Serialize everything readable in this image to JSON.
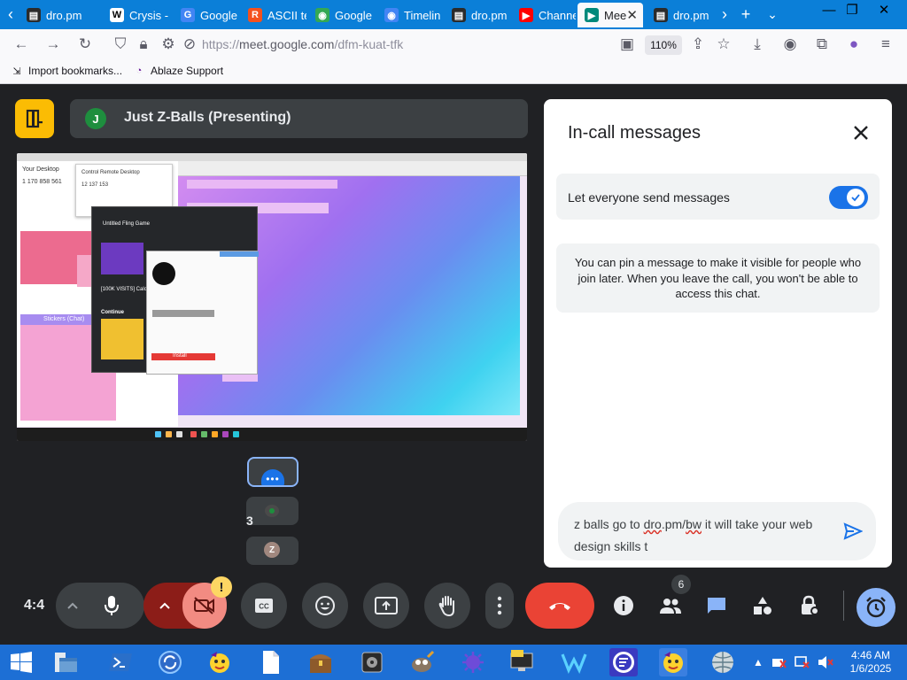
{
  "browser": {
    "tabs": [
      {
        "label": "dro.pm",
        "icon": "film-icon",
        "color": "#2b2b2b"
      },
      {
        "label": "Crysis -",
        "icon": "wikipedia-icon",
        "color": "#ffffff"
      },
      {
        "label": "Google",
        "icon": "google-translate-icon",
        "color": "#4285f4"
      },
      {
        "label": "ASCII te",
        "icon": "r-icon",
        "color": "#f4511e"
      },
      {
        "label": "Google",
        "icon": "maps-pin-icon",
        "color": "#34a853"
      },
      {
        "label": "Timelin",
        "icon": "maps-pin-icon",
        "color": "#4285f4"
      },
      {
        "label": "dro.pm",
        "icon": "film-icon",
        "color": "#2b2b2b"
      },
      {
        "label": "Channe",
        "icon": "youtube-icon",
        "color": "#ff0000"
      },
      {
        "label": "Mee",
        "icon": "meet-icon",
        "color": "#00897b"
      },
      {
        "label": "dro.pm",
        "icon": "film-icon",
        "color": "#2b2b2b"
      }
    ],
    "url_prefix": "https://",
    "url_host": "meet.google.com",
    "url_path": "/dfm-kuat-tfk",
    "zoom": "110%",
    "bookmarks": [
      {
        "label": "Import bookmarks...",
        "icon": "import-icon"
      },
      {
        "label": "Ablaze Support",
        "icon": "ablaze-icon"
      }
    ]
  },
  "meet": {
    "presenter_initial": "J",
    "presenter_name": "Just Z-Balls (Presenting)",
    "tile2_count": "3",
    "tile3_initial": "Z",
    "left_time": "4:4",
    "people_count": "6",
    "chat": {
      "title": "In-call messages",
      "toggle_label": "Let everyone send messages",
      "toggle_on": true,
      "pin_note": "You can pin a message to make it visible for people who join later. When you leave the call, you won't be able to access this chat.",
      "compose_parts": [
        "z balls go to ",
        "dro",
        ".pm/",
        "bw",
        " it will take your web design skills t"
      ]
    },
    "colors": {
      "accent": "#1a73e8",
      "end_call": "#ea4335",
      "cam_off": "#f28b82",
      "warning": "#fdd663",
      "meet_logo": "#fbbc04"
    }
  },
  "shared_screen": {
    "desktop_title": "Your Desktop",
    "dialog_title": "Control Remote Desktop",
    "dialog_code": "1 170 858 561",
    "dialog_code2": "12 137 153",
    "section_left": "Untitled Fling Game",
    "section_left2": "[100K VISITS] Calcula",
    "section_left3": "Continue",
    "stickers_label": "Stickers (Chat)",
    "red_button": "Install"
  },
  "taskbar": {
    "time": "4:46 AM",
    "date": "1/6/2025"
  }
}
